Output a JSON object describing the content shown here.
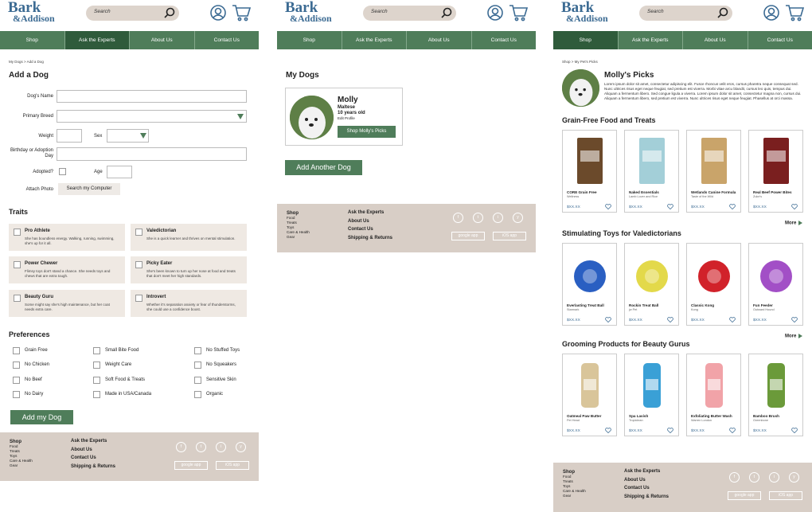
{
  "brand": {
    "line1": "Bark",
    "line2": "&Addison"
  },
  "search": {
    "placeholder": "Search"
  },
  "nav": [
    "Shop",
    "Ask the Experts",
    "About Us",
    "Contact Us"
  ],
  "footer": {
    "shop_title": "Shop",
    "shop_items": [
      "Food",
      "Treats",
      "Toys",
      "Care & Health",
      "Gear"
    ],
    "links": [
      "Ask the Experts",
      "About Us",
      "Contact Us",
      "Shipping & Returns"
    ],
    "social": [
      "f",
      "t",
      "i",
      "y"
    ],
    "apps": [
      "google app",
      "iOS app"
    ]
  },
  "add_dog": {
    "breadcrumb": "My Dogs > Add a Dog",
    "title": "Add a Dog",
    "labels": {
      "name": "Dog's Name",
      "breed": "Primary Breed",
      "weight": "Weight",
      "sex": "Sex",
      "birthday": "Birthday or Adoption Day",
      "adopted": "Adopted?",
      "age": "Age",
      "photo": "Attach Photo"
    },
    "photo_button": "Search my Computer",
    "traits_title": "Traits",
    "traits": [
      {
        "name": "Pro Athlete",
        "desc": "She has boundless energy. Walking, running, swimming, she's up for it all."
      },
      {
        "name": "Valedictorian",
        "desc": "She is a quick learner and thrives on mental stimulation."
      },
      {
        "name": "Power Chewer",
        "desc": "Flimsy toys don't stand a chance. She needs toys and chews that are extra tough."
      },
      {
        "name": "Picky Eater",
        "desc": "She's been known to turn up her nose at food and treats that don't meet her high standards."
      },
      {
        "name": "Beauty Guru",
        "desc": "Some might say she's high maintenance, but her coat needs extra care."
      },
      {
        "name": "Introvert",
        "desc": "Whether it's separation anxiety or fear of thunderstorms, she could use a confidence boost."
      }
    ],
    "prefs_title": "Preferences",
    "prefs": [
      "Grain Free",
      "No Chicken",
      "No Beef",
      "No Dairy",
      "Small Bite Food",
      "Weight Care",
      "Soft Food & Treats",
      "Made in USA/Canada",
      "No Stuffed Toys",
      "No Squeakers",
      "Sensitive Skin",
      "Organic"
    ],
    "submit": "Add my Dog"
  },
  "my_dogs": {
    "title": "My Dogs",
    "dog": {
      "name": "Molly",
      "breed": "Maltese",
      "age": "10 years old",
      "edit": "Edit Profile",
      "button": "Shop Molly's Picks"
    },
    "add_button": "Add Another Dog"
  },
  "picks": {
    "breadcrumb": "Shop > My Pet's Picks",
    "title": "Molly's Picks",
    "intro": "Lorem ipsum dolor sit amet, consectetur adipiscing elit. Fusce rhoncus velit eros, cursus pharetra neque consequat sed. Nunc ultrices risus eget neque feugiat, sed pretium est viverra. Morbi vitae arcu blandit, cursus leo quis, tempus dui. Aliquam a fermentum libero. Sed congue ligula a viverra. Lorem ipsum dolor sit amet, consectetur magna non, cursus dui. Aliquam a fermentum libero, sed pretium est viverra. Nunc ultrices risus eget neque feugiat. Phasellus at orci massa.",
    "more": "More",
    "sections": [
      {
        "title": "Grain-Free Food and Treats",
        "products": [
          {
            "name": "CORE Grain Free",
            "brand": "Wellness",
            "price": "$XX.XX"
          },
          {
            "name": "Naked Essentials",
            "brand": "Lamb Lover and Rice",
            "price": "$XX.XX"
          },
          {
            "name": "Wetlands Canine Formula",
            "brand": "Taste of the Wild",
            "price": "$XX.XX"
          },
          {
            "name": "Real Beef Power Bites",
            "brand": "Zuke's",
            "price": "$XX.XX"
          }
        ]
      },
      {
        "title": "Stimulating Toys for Valedictorians",
        "products": [
          {
            "name": "Everlasting Treat Ball",
            "brand": "Starmark",
            "price": "$XX.XX"
          },
          {
            "name": "Rockin Treat Ball",
            "brand": "jw Pet",
            "price": "$XX.XX"
          },
          {
            "name": "Classic Kong",
            "brand": "Kong",
            "price": "$XX.XX"
          },
          {
            "name": "Fun Feeder",
            "brand": "Outward Hound",
            "price": "$XX.XX"
          }
        ]
      },
      {
        "title": "Grooming Products for Beauty Gurus",
        "products": [
          {
            "name": "Oatmeal Paw Butter",
            "brand": "Pet Head",
            "price": "$XX.XX"
          },
          {
            "name": "Spa Lavish",
            "brand": "Tropiclean",
            "price": "$XX.XX"
          },
          {
            "name": "Exfoliating Butter Wash",
            "brand": "Warren London",
            "price": "$XX.XX"
          },
          {
            "name": "Bamboo Brush",
            "brand": "Greenbone",
            "price": "$XX.XX"
          }
        ]
      }
    ]
  },
  "colors": {
    "nav_green": "#4f7d5a",
    "nav_active": "#2f5b3b",
    "brand_blue": "#3c6b93",
    "footer_bg": "#d8cec6",
    "trait_bg": "#efe9e3"
  }
}
